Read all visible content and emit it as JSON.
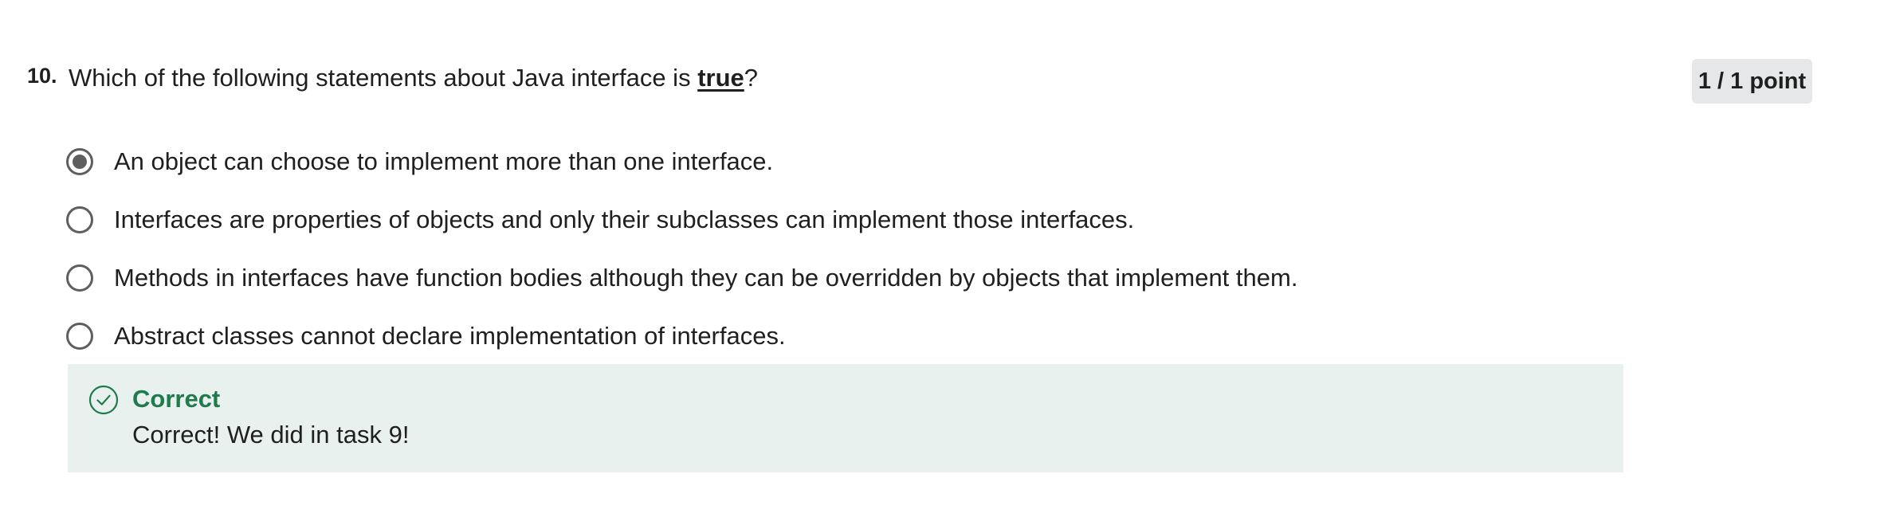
{
  "question": {
    "number": "10.",
    "text_before": "Which of the following statements about Java interface is ",
    "text_emphasis": "true",
    "text_after": "?",
    "points": "1 / 1 point"
  },
  "options": [
    {
      "label": "An object can choose to implement more than one interface.",
      "selected": true
    },
    {
      "label": "Interfaces are properties of objects and only their subclasses can implement those interfaces.",
      "selected": false
    },
    {
      "label": "Methods in interfaces have function bodies although they can be overridden by objects that implement them.",
      "selected": false
    },
    {
      "label": "Abstract classes cannot declare implementation of interfaces.",
      "selected": false
    }
  ],
  "feedback": {
    "icon": "check-circle-icon",
    "title": "Correct",
    "message": "Correct! We did in task 9!",
    "accent_color": "#1f7a4d",
    "background_color": "#e8f1ee"
  }
}
